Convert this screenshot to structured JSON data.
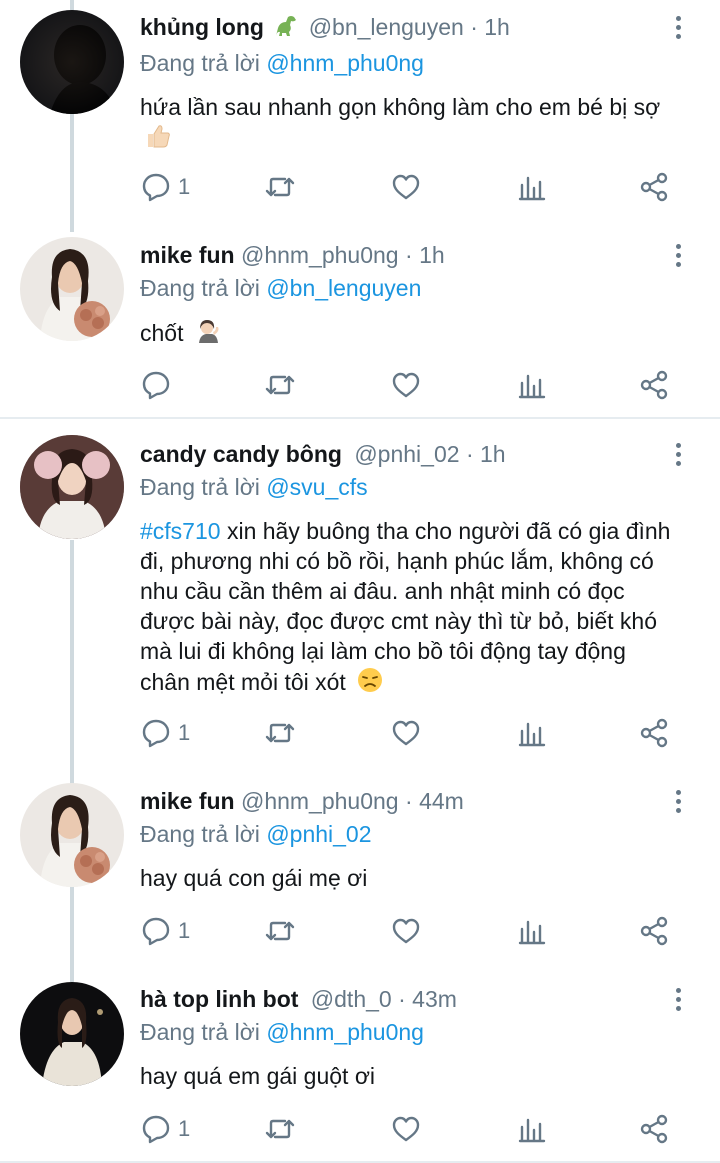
{
  "colors": {
    "accent": "#1b95e0",
    "muted": "#657786",
    "text": "#14171a",
    "divider": "#e6ecf0",
    "thread_line": "#cfd9de"
  },
  "tweets": [
    {
      "name": "khủng long",
      "name_emoji_icon": "dinosaur-emoji",
      "handle": "@bn_lenguyen",
      "time": "1h",
      "reply_prefix": "Đang trả lời",
      "reply_to": "@hnm_phu0ng",
      "body": "hứa lần sau nhanh gọn không làm cho em bé bị sợ",
      "body_emoji_icon": "thumbs-up-emoji",
      "reply_count": "1"
    },
    {
      "name": "mike fun",
      "handle": "@hnm_phu0ng",
      "time": "1h",
      "reply_prefix": "Đang trả lời",
      "reply_to": "@bn_lenguyen",
      "body": "chốt",
      "body_emoji_icon": "woman-tipping-hand-emoji",
      "reply_count": ""
    },
    {
      "name": "candy candy bông",
      "handle": "@pnhi_02",
      "time": "1h",
      "reply_prefix": "Đang trả lời",
      "reply_to": "@svu_cfs",
      "hashtag": "#cfs710",
      "body": " xin hãy buông tha cho người đã có gia đình đi, phương nhi có bồ rồi, hạnh phúc lắm, không có nhu cầu cần thêm ai đâu. anh nhật minh có đọc được bài này, đọc được cmt này thì từ bỏ, biết khó mà lui đi không lại làm cho bồ tôi động tay động chân mệt mỏi tôi xót",
      "body_emoji_icon": "persevering-face-emoji",
      "reply_count": "1"
    },
    {
      "name": "mike fun",
      "handle": "@hnm_phu0ng",
      "time": "44m",
      "reply_prefix": "Đang trả lời",
      "reply_to": "@pnhi_02",
      "body": "hay quá con gái mẹ ơi",
      "reply_count": "1"
    },
    {
      "name": "hà top linh bot",
      "handle": "@dth_0",
      "time": "43m",
      "reply_prefix": "Đang trả lời",
      "reply_to": "@hnm_phu0ng",
      "body": "hay quá em gái guột ơi",
      "reply_count": "1"
    }
  ]
}
